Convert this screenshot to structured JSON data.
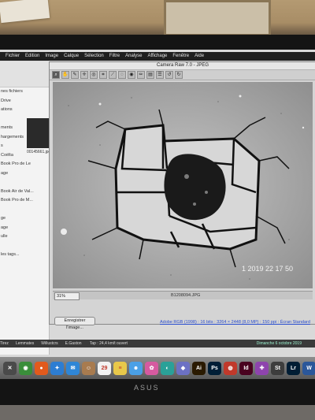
{
  "menubar": {
    "items": [
      "",
      "Fichier",
      "Edition",
      "Image",
      "Calque",
      "Sélection",
      "Filtre",
      "Analyse",
      "Affichage",
      "Fenêtre",
      "Aide"
    ]
  },
  "finder": {
    "items": [
      "nes fichiers",
      "Drive",
      "ations",
      "",
      "ments",
      "hargements",
      "s",
      "Coëlta",
      "Book Pro de Le",
      "age",
      "",
      "Book Air de Val...",
      "Book Pro de M...",
      "",
      "ge",
      "age",
      "ulle",
      "",
      "les tags..."
    ],
    "thumb_label": "00145661.jpg"
  },
  "dialog": {
    "title": "Camera Raw 7.0 - JPEG",
    "zoom": "31%",
    "filename": "B1208094.JPG",
    "save_label": "Enregistrer l'image...",
    "info_link": "Adobe RGB (1998) : 16 bits : 3264 × 2448 (8,0 MP) : 150 ppi : Écran Standard"
  },
  "photo": {
    "date_stamp": "1    2019  22  17  50"
  },
  "psbar": {
    "tabs": [
      "E.Gaston",
      "Willustcrs",
      "Lemmates",
      "Tirez"
    ],
    "zoom": "Tap : 24,4 km/t ouvert",
    "status": "Dimanche 6 octobre 2019"
  },
  "dock": {
    "icons": [
      {
        "name": "x-icon",
        "label": "✕",
        "color": "#4a4a4a"
      },
      {
        "name": "chrome-icon",
        "label": "◉",
        "color": "#3a8e3a"
      },
      {
        "name": "firefox-icon",
        "label": "●",
        "color": "#e25a1c"
      },
      {
        "name": "safari-icon",
        "label": "✦",
        "color": "#2d7dd2"
      },
      {
        "name": "mail-icon",
        "label": "✉",
        "color": "#2f86d6"
      },
      {
        "name": "contacts-icon",
        "label": "☺",
        "color": "#a87b4f"
      },
      {
        "name": "calendar-icon",
        "label": "29",
        "color": "#f2f2f2"
      },
      {
        "name": "notes-icon",
        "label": "≡",
        "color": "#e8c84a"
      },
      {
        "name": "finder-icon",
        "label": "☻",
        "color": "#4aa0e6"
      },
      {
        "name": "photos-icon",
        "label": "✿",
        "color": "#d65aa0"
      },
      {
        "name": "app-icon-1",
        "label": "◐",
        "color": "#2aa198"
      },
      {
        "name": "app-icon-2",
        "label": "◆",
        "color": "#6c71c4"
      },
      {
        "name": "illustrator-icon",
        "label": "Ai",
        "color": "#2a1a00"
      },
      {
        "name": "photoshop-icon",
        "label": "Ps",
        "color": "#001e36"
      },
      {
        "name": "app-icon-3",
        "label": "◍",
        "color": "#c0392b"
      },
      {
        "name": "indesign-icon",
        "label": "Id",
        "color": "#49021f"
      },
      {
        "name": "app-icon-4",
        "label": "✚",
        "color": "#8e44ad"
      },
      {
        "name": "app-icon-5",
        "label": "St",
        "color": "#3d3d3d"
      },
      {
        "name": "lightroom-icon",
        "label": "Lr",
        "color": "#001d34"
      },
      {
        "name": "word-icon",
        "label": "W",
        "color": "#2b579a"
      }
    ]
  },
  "monitor": {
    "brand": "ASUS"
  }
}
